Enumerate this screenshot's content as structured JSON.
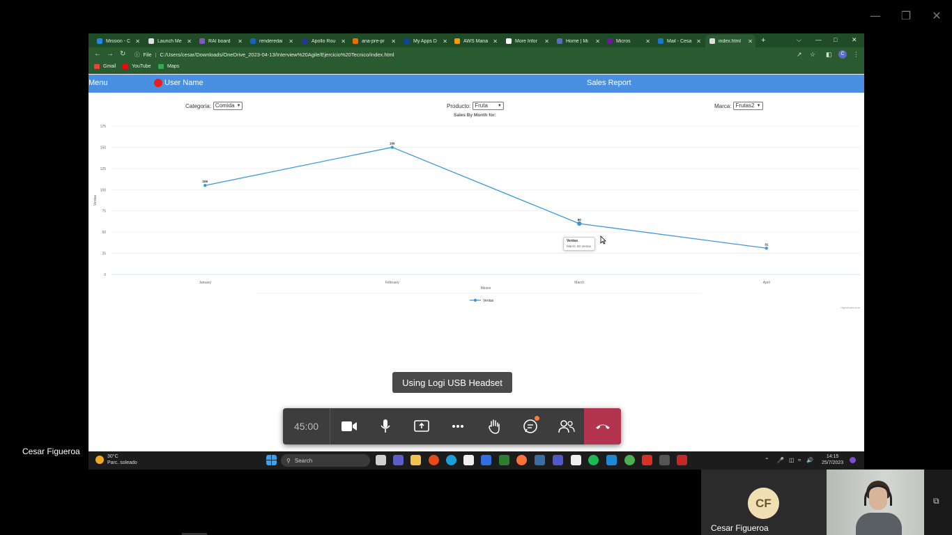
{
  "browser": {
    "tabs": [
      {
        "label": "Mission - C",
        "color": "#1e88e5"
      },
      {
        "label": "Launch Me",
        "color": "#e0e0e0"
      },
      {
        "label": "RAI board",
        "color": "#7e57c2"
      },
      {
        "label": "renderedai",
        "color": "#1565c0"
      },
      {
        "label": "Apollo Rou",
        "color": "#283593"
      },
      {
        "label": "ana-pre-pr",
        "color": "#ef6c00"
      },
      {
        "label": "My Apps D",
        "color": "#0d47a1"
      },
      {
        "label": "AWS Mana",
        "color": "#ff9800"
      },
      {
        "label": "More Infor",
        "color": "#ffffff"
      },
      {
        "label": "Home | Mi",
        "color": "#5c6bc0"
      },
      {
        "label": "Micros",
        "color": "#6a1b9a"
      },
      {
        "label": "Mail - Cesa",
        "color": "#1976d2"
      },
      {
        "label": "index.html",
        "color": "#e0e0e0"
      }
    ],
    "url_info": "File",
    "url": "C:/Users/cesar/Downloads/OneDrive_2023-04-13/Interview%20Agile/Ejercicio%20Tecnico/index.html",
    "profile_initial": "C",
    "bookmarks": [
      {
        "label": "Gmail",
        "color": "#ea4335"
      },
      {
        "label": "YouTube",
        "color": "#ff0000"
      },
      {
        "label": "Maps",
        "color": "#34a853"
      }
    ]
  },
  "app": {
    "menu_label": "Menu",
    "user_name": "User Name",
    "title": "Sales Report",
    "filters": {
      "categoria_label": "Categoria:",
      "categoria_value": "Comida",
      "producto_label": "Producto:",
      "producto_value": "Fruta",
      "marca_label": "Marca:",
      "marca_value": "Frutas2"
    }
  },
  "chart_data": {
    "type": "line",
    "title": "Sales By Month for:",
    "categories": [
      "January",
      "February",
      "March",
      "April"
    ],
    "series": [
      {
        "name": "Ventas",
        "values": [
          105,
          150,
          60,
          31
        ],
        "color": "#3a9ad9"
      }
    ],
    "data_labels": [
      "105",
      "150",
      "60",
      "31"
    ],
    "xlabel": "Meses",
    "ylabel": "Ventas",
    "ylim": [
      0,
      175
    ],
    "yticks": [
      0,
      25,
      50,
      75,
      100,
      125,
      150,
      175
    ],
    "grid": true,
    "legend": "bottom",
    "credit": "Highcharts.com",
    "tooltip": {
      "title": "Ventas",
      "text": "March: 60 Ventas"
    }
  },
  "taskbar": {
    "weather_temp": "30°C",
    "weather_desc": "Parc. soleado",
    "search_label": "Search",
    "time": "14:15",
    "date": "25/7/2023"
  },
  "meeting": {
    "toast": "Using Logi USB Headset",
    "timer": "45:00",
    "presenter": "Cesar Figueroa",
    "participant_initials": "CF",
    "participant_name": "Cesar Figueroa",
    "end_color": "#b3344f"
  }
}
